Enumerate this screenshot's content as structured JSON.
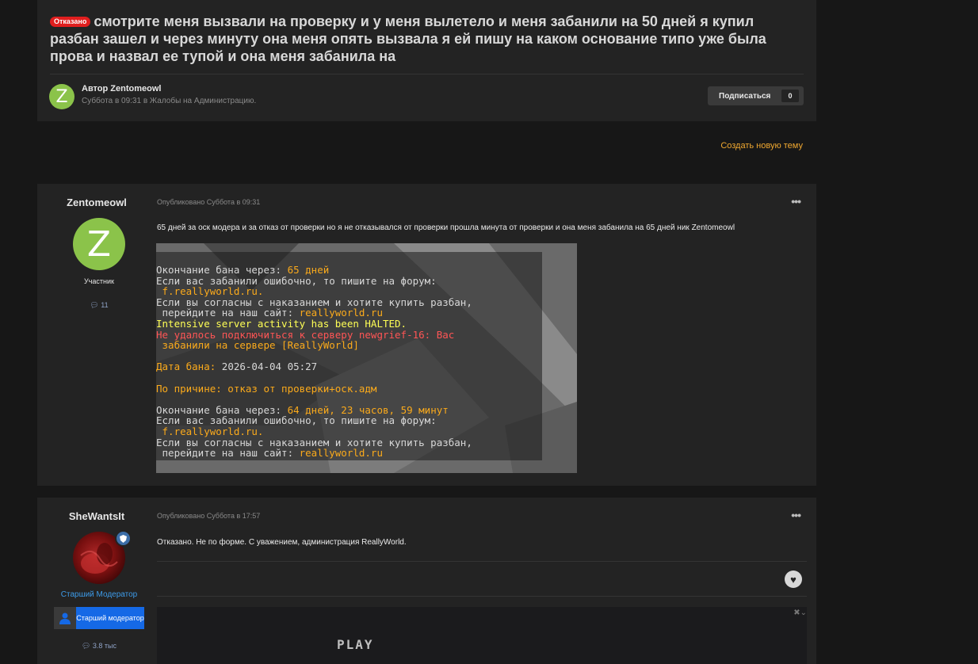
{
  "topic": {
    "badge": "Отказано",
    "title": "смотрите меня вызвали на проверку и у меня вылетело и меня забанили на 50 дней я купил разбан зашел и через минуту она меня опять вызвала я ей пишу на каком основание типо уже была прова и назвал ее тупой и она меня забанила на",
    "author_avatar_letter": "Z",
    "author_line": "Автор Zentomeowl",
    "meta_line": "Суббота в 09:31 в Жалобы на Администрацию.",
    "follow_label": "Подписаться",
    "follow_count": "0"
  },
  "create_topic_label": "Создать новую тему",
  "posts": [
    {
      "username": "Zentomeowl",
      "avatar_letter": "Z",
      "rank": "Участник",
      "post_count": "11",
      "published": "Опубликовано Суббота в 09:31",
      "menu": "•••",
      "text": "65 дней за оск модера и за отказ от проверки но я не отказывался от проверки прошла минута от проверки и она меня забанила на 65 дней ник Zentomeowl",
      "screenshot": {
        "l1a": "Окончание бана через: ",
        "l1b": "65 дней",
        "l2": "Если вас забанили ошибочно, то пишите на форум:",
        "l3": " f.reallyworld.ru.",
        "l4": "Если вы согласны с наказанием и хотите купить разбан,",
        "l5a": " перейдите на наш сайт: ",
        "l5b": "reallyworld.ru",
        "l6": "Intensive server activity has been HALTED.",
        "l7": "Не удалось подключиться к серверу newgrief-16: Вас",
        "l8": " забанили на сервере [ReallyWorld]",
        "l9a": "Дата бана: ",
        "l9b": "2026-04-04 05:27",
        "l10": "По причине: отказ от проверки+оск.адм",
        "l11a": "Окончание бана через: ",
        "l11b": "64 дней, 23 часов, 59 минут",
        "l12": "Если вас забанили ошибочно, то пишите на форум:",
        "l13": " f.reallyworld.ru.",
        "l14": "Если вы согласны с наказанием и хотите купить разбан,",
        "l15a": " перейдите на наш сайт: ",
        "l15b": "reallyworld.ru"
      }
    },
    {
      "username": "SheWantsIt",
      "rank": "Старший Модератор",
      "staff_badge": "Старший модератор",
      "post_count": "3.8 тыс",
      "published": "Опубликовано Суббота в 17:57",
      "menu": "•••",
      "text": "Отказано. Не по форме. С уважением, администрация ReallyWorld.",
      "video_label": "PLAY"
    }
  ],
  "colors": {
    "accent": "#f0a830",
    "refused": "#e01e1e",
    "mod_rank": "#3d9be9",
    "staff_badge": "#1569e6",
    "avatar_green": "#8bc34a"
  }
}
